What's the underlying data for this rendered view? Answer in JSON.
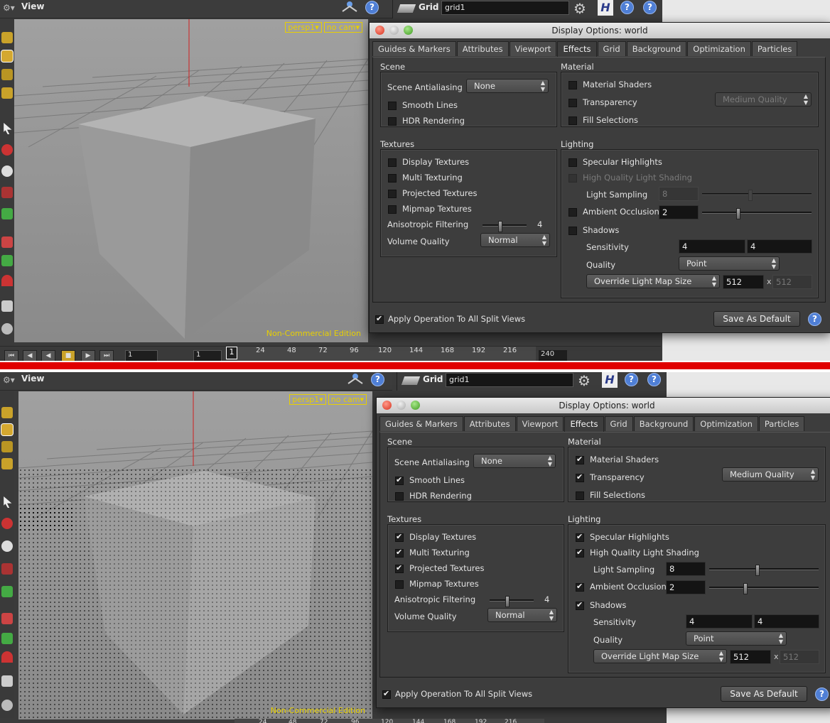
{
  "viewer": {
    "title": "View",
    "camera": "persp1",
    "cam_menu": "no cam",
    "edition": "Non-Commercial Edition"
  },
  "playbar": {
    "start_frame": "1",
    "range_start": "1",
    "current_frame": "1",
    "end_frame": "240",
    "ticks": [
      "24",
      "48",
      "72",
      "96",
      "120",
      "144",
      "168",
      "192",
      "216"
    ],
    "ticks_bottom": [
      "24",
      "48",
      "72",
      "96",
      "120",
      "144",
      "168",
      "192",
      "216"
    ]
  },
  "node": {
    "type_label": "Grid",
    "name": "grid1",
    "help": "?"
  },
  "dialog": {
    "title": "Display Options:  world",
    "tabs": [
      "Guides & Markers",
      "Attributes",
      "Viewport",
      "Effects",
      "Grid",
      "Background",
      "Optimization",
      "Particles"
    ],
    "active_tab": "Effects",
    "scene_title": "Scene",
    "scene_aa_label": "Scene Antialiasing",
    "scene_aa_value": "None",
    "smooth_lines": "Smooth Lines",
    "hdr_rendering": "HDR Rendering",
    "material_title": "Material",
    "material_shaders": "Material Shaders",
    "transparency": "Transparency",
    "transparency_quality": "Medium Quality",
    "fill_selections": "Fill Selections",
    "textures_title": "Textures",
    "display_textures": "Display Textures",
    "multi_texturing": "Multi Texturing",
    "projected_textures": "Projected Textures",
    "mipmap_textures": "Mipmap Textures",
    "aniso_label": "Anisotropic Filtering",
    "aniso_value": "4",
    "volume_quality_label": "Volume Quality",
    "volume_quality_value": "Normal",
    "lighting_title": "Lighting",
    "specular": "Specular Highlights",
    "hq_light": "High Quality Light Shading",
    "light_sampling_label": "Light Sampling",
    "light_sampling_value": "8",
    "ambient_label": "Ambient Occlusion",
    "ambient_value": "2",
    "shadows": "Shadows",
    "sensitivity_label": "Sensitivity",
    "sensitivity_a": "4",
    "sensitivity_b": "4",
    "quality_label": "Quality",
    "quality_value": "Point",
    "override_label": "Override Light Map Size",
    "map_w": "512",
    "map_x": "x",
    "map_h": "512",
    "apply_all": "Apply Operation To All Split Views",
    "save_default": "Save As Default",
    "help": "?"
  },
  "state_top": {
    "smooth_lines": false,
    "hdr": false,
    "material_shaders": false,
    "transparency": false,
    "fill": false,
    "display_tex": false,
    "multi_tex": false,
    "proj_tex": false,
    "mipmap": false,
    "specular": false,
    "hq_light": false,
    "ambient": false,
    "shadows": false,
    "apply_all": true,
    "aniso_level": 0.4,
    "light_sampling_level": 0.44,
    "ambient_level": 0.33
  },
  "state_bottom": {
    "smooth_lines": true,
    "hdr": false,
    "material_shaders": true,
    "transparency": true,
    "fill": false,
    "display_tex": true,
    "multi_tex": true,
    "proj_tex": true,
    "mipmap": false,
    "specular": true,
    "hq_light": true,
    "ambient": true,
    "shadows": true,
    "apply_all": true,
    "aniso_level": 0.4,
    "light_sampling_level": 0.44,
    "ambient_level": 0.33
  }
}
